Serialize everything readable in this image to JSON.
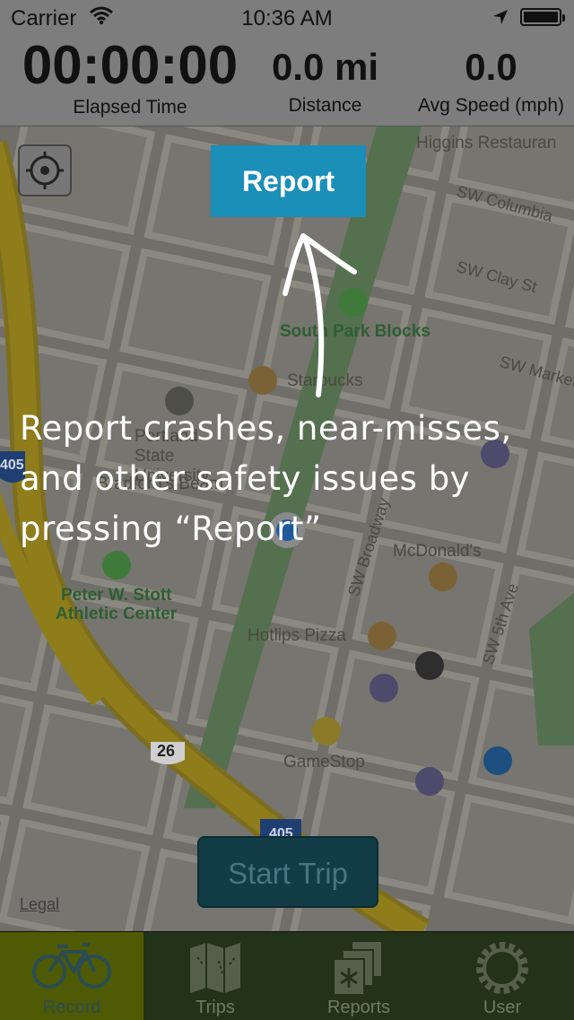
{
  "status_bar": {
    "carrier": "Carrier",
    "time": "10:36 AM"
  },
  "stats": [
    {
      "value": "00:00:00",
      "label": "Elapsed Time"
    },
    {
      "value": "0.0 mi",
      "label": "Distance"
    },
    {
      "value": "0.0",
      "label": "Avg Speed (mph)"
    }
  ],
  "map": {
    "places": [
      "Higgins Restauran",
      "South Park Blocks",
      "Starbucks",
      "Portland State University",
      "Bradford's Beam",
      "McDonald's",
      "Peter W. Stott",
      "Athletic Center",
      "Hotlips Pizza",
      "GameStop"
    ],
    "streets": [
      "SW Columbia",
      "SW Clay St",
      "SW Market",
      "SW Broadway",
      "SW 5th Ave"
    ],
    "shields": [
      "405",
      "26",
      "405"
    ],
    "legal_link": "Legal"
  },
  "report_button": "Report",
  "tooltip": "Report crashes, near-misses, and other safety issues by pressing “Report”",
  "start_button": "Start Trip",
  "tabs": [
    {
      "label": "Record",
      "icon": "bicycle-icon",
      "active": true
    },
    {
      "label": "Trips",
      "icon": "map-icon",
      "active": false
    },
    {
      "label": "Reports",
      "icon": "reports-icon",
      "active": false
    },
    {
      "label": "User",
      "icon": "gear-icon",
      "active": false
    }
  ],
  "colors": {
    "report_button": "#1a8fb8",
    "tab_active": "#4f5a04",
    "tab_bar": "#23331a",
    "start_button": "#123c46"
  }
}
